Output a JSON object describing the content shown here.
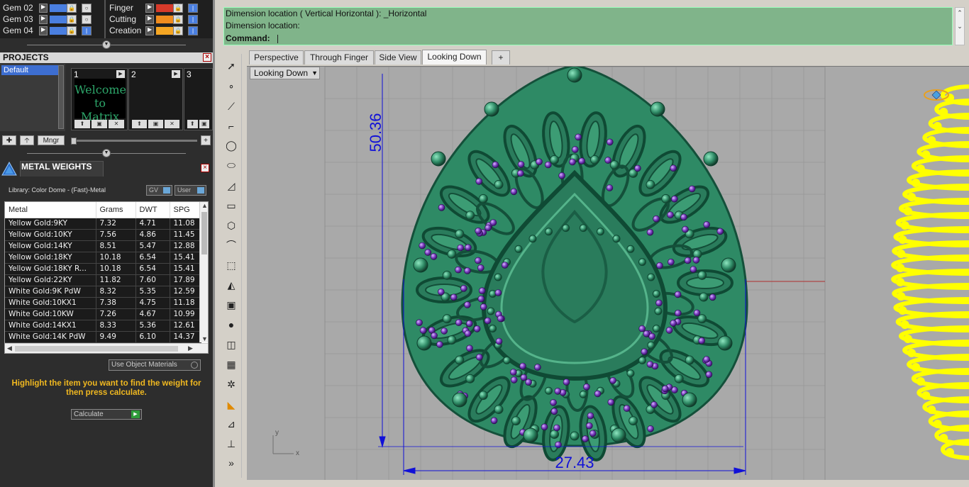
{
  "layers": [
    {
      "name": "Gem 02",
      "color": "#4a7fe0"
    },
    {
      "name": "Gem 03",
      "color": "#4a7fe0"
    },
    {
      "name": "Gem 04",
      "color": "#4a7fe0"
    },
    {
      "name": "Finger",
      "color": "#d63a2a"
    },
    {
      "name": "Cutting",
      "color": "#f08c1e"
    },
    {
      "name": "Creation",
      "color": "#f5a623"
    }
  ],
  "projects": {
    "title": "PROJECTS",
    "list": [
      "Default"
    ],
    "slots": [
      {
        "num": "1",
        "thumb_text": "Welcome to Matrix"
      },
      {
        "num": "2",
        "thumb_text": ""
      },
      {
        "num": "3",
        "thumb_text": ""
      }
    ],
    "mngr_label": "Mngr"
  },
  "metal_weights": {
    "title": "METAL WEIGHTS",
    "library": "Library: Color Dome - (Fast)-Metal",
    "gv_label": "GV",
    "user_label": "User",
    "columns": [
      "Metal",
      "Grams",
      "DWT",
      "SPG"
    ],
    "rows": [
      [
        "Yellow Gold:9KY",
        "7.32",
        "4.71",
        "11.08"
      ],
      [
        "Yellow Gold:10KY",
        "7.56",
        "4.86",
        "11.45"
      ],
      [
        "Yellow Gold:14KY",
        "8.51",
        "5.47",
        "12.88"
      ],
      [
        "Yellow Gold:18KY",
        "10.18",
        "6.54",
        "15.41"
      ],
      [
        "Yellow Gold:18KY R...",
        "10.18",
        "6.54",
        "15.41"
      ],
      [
        "Yellow Gold:22KY",
        "11.82",
        "7.60",
        "17.89"
      ],
      [
        "White Gold:9K PdW",
        "8.32",
        "5.35",
        "12.59"
      ],
      [
        "White Gold:10KX1",
        "7.38",
        "4.75",
        "11.18"
      ],
      [
        "White Gold:10KW",
        "7.26",
        "4.67",
        "10.99"
      ],
      [
        "White Gold:14KX1",
        "8.33",
        "5.36",
        "12.61"
      ],
      [
        "White Gold:14K PdW",
        "9.49",
        "6.10",
        "14.37"
      ]
    ],
    "use_object_materials": "Use Object Materials",
    "hint": "Highlight the item you want to find the weight for then press calculate.",
    "calculate": "Calculate"
  },
  "command": {
    "line1": "Dimension location ( Vertical  Horizontal ): _Horizontal",
    "line2": "Dimension location:",
    "prompt": "Command:"
  },
  "viewport_tabs": [
    "Perspective",
    "Through Finger",
    "Side View",
    "Looking Down",
    "+"
  ],
  "active_tab": "Looking Down",
  "viewport_label": "Looking Down",
  "dimensions": {
    "vertical": "50.36",
    "horizontal": "27.43"
  },
  "axes": {
    "x": "x",
    "y": "y"
  },
  "colors": {
    "model": "#2e8a65",
    "gems": "#7a3fc0",
    "dimension": "#1010d8",
    "command_bg": "#80b48a",
    "selection": "#ffff00"
  }
}
